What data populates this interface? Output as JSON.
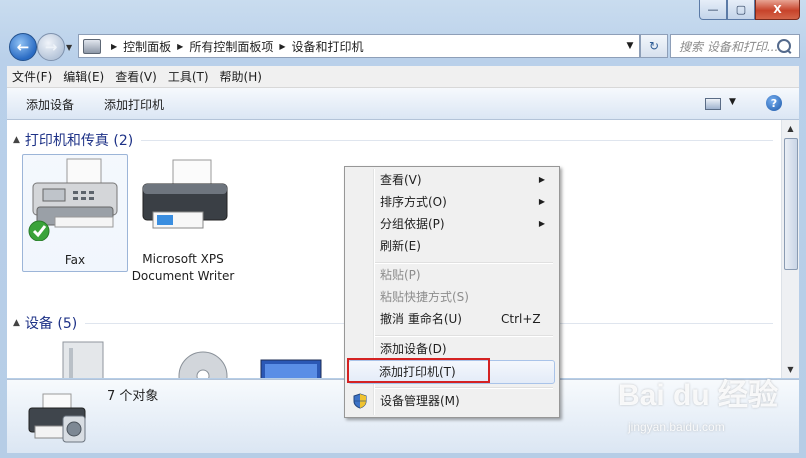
{
  "titlebar": {
    "minimize": "—",
    "maximize": "▢",
    "close": "X"
  },
  "nav": {
    "back": "←",
    "forward": "→"
  },
  "address": {
    "crumbs": [
      "控制面板",
      "所有控制面板项",
      "设备和打印机"
    ]
  },
  "search": {
    "placeholder": "搜索 设备和打印..."
  },
  "menubar": {
    "items": [
      "文件(F)",
      "编辑(E)",
      "查看(V)",
      "工具(T)",
      "帮助(H)"
    ]
  },
  "commandbar": {
    "add_device": "添加设备",
    "add_printer": "添加打印机",
    "help": "?"
  },
  "groups": {
    "printers": {
      "title": "打印机和传真 (2)",
      "items": [
        "Fax",
        "Microsoft XPS Document Writer"
      ]
    },
    "devices": {
      "title": "设备 (5)"
    }
  },
  "details": {
    "count": "7 个对象"
  },
  "context_menu": {
    "items": [
      {
        "label": "查看(V)",
        "submenu": true
      },
      {
        "label": "排序方式(O)",
        "submenu": true
      },
      {
        "label": "分组依据(P)",
        "submenu": true
      },
      {
        "label": "刷新(E)"
      },
      {
        "label": "粘贴(P)",
        "disabled": true
      },
      {
        "label": "粘贴快捷方式(S)",
        "disabled": true
      },
      {
        "label": "撤消 重命名(U)",
        "shortcut": "Ctrl+Z"
      },
      {
        "label": "添加设备(D)"
      },
      {
        "label": "添加打印机(T)",
        "highlighted": true
      },
      {
        "label": "设备管理器(M)",
        "icon": "shield-icon"
      }
    ]
  },
  "watermark": {
    "logo": "Bai du 经验",
    "url": "jingyan.baidu.com"
  },
  "colors": {
    "group_title": "#1e3287",
    "highlight_box": "#d42222",
    "accent": "#2a6bc3"
  }
}
